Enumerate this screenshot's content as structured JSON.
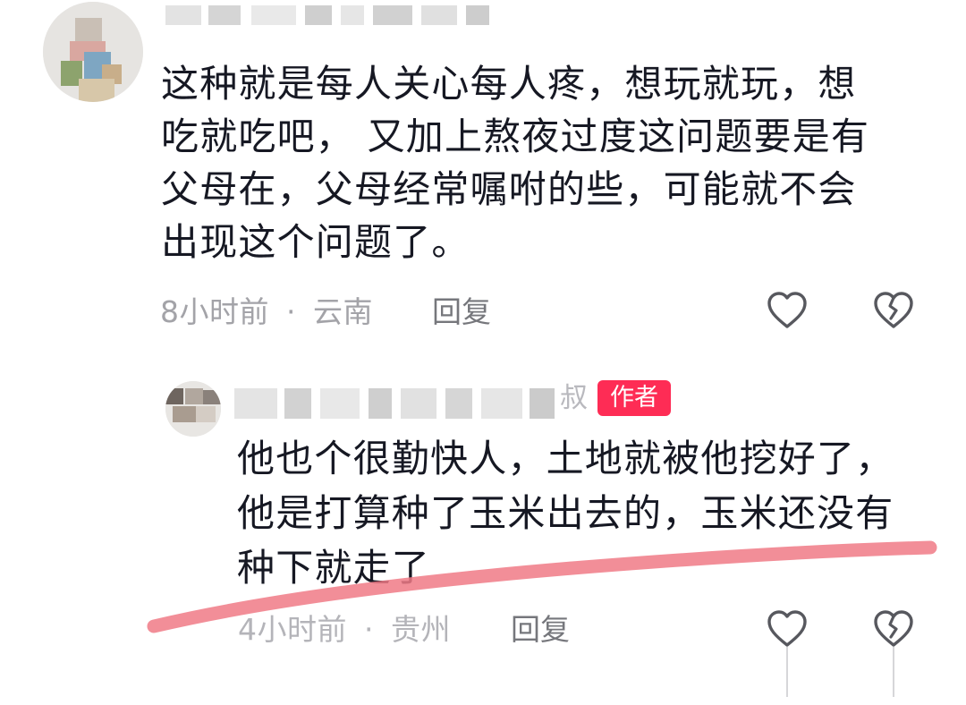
{
  "comments": [
    {
      "text_lines": [
        "这种就是每人关心每人疼，想玩就玩，想",
        "吃就吃吧， 又加上熬夜过度这问题要是有",
        "父母在，父母经常嘱咐的些，可能就不会",
        "出现这个问题了。"
      ],
      "time": "8小时前",
      "dot": "·",
      "location": "云南",
      "reply_label": "回复"
    },
    {
      "name_tail": "叔",
      "badge": "作者",
      "text_lines": [
        "他也个很勤快人，土地就被他挖好了，",
        "他是打算种了玉米出去的，玉米还没有",
        "种下就走了"
      ],
      "time": "4小时前",
      "dot": "·",
      "location": "贵州",
      "reply_label": "回复"
    }
  ],
  "icons": {
    "like": "heart-outline-icon",
    "dislike": "broken-heart-icon"
  },
  "colors": {
    "badge": "#fe2c55",
    "annotation_stroke": "#f07a86",
    "meta_text": "#a3a3a8"
  }
}
